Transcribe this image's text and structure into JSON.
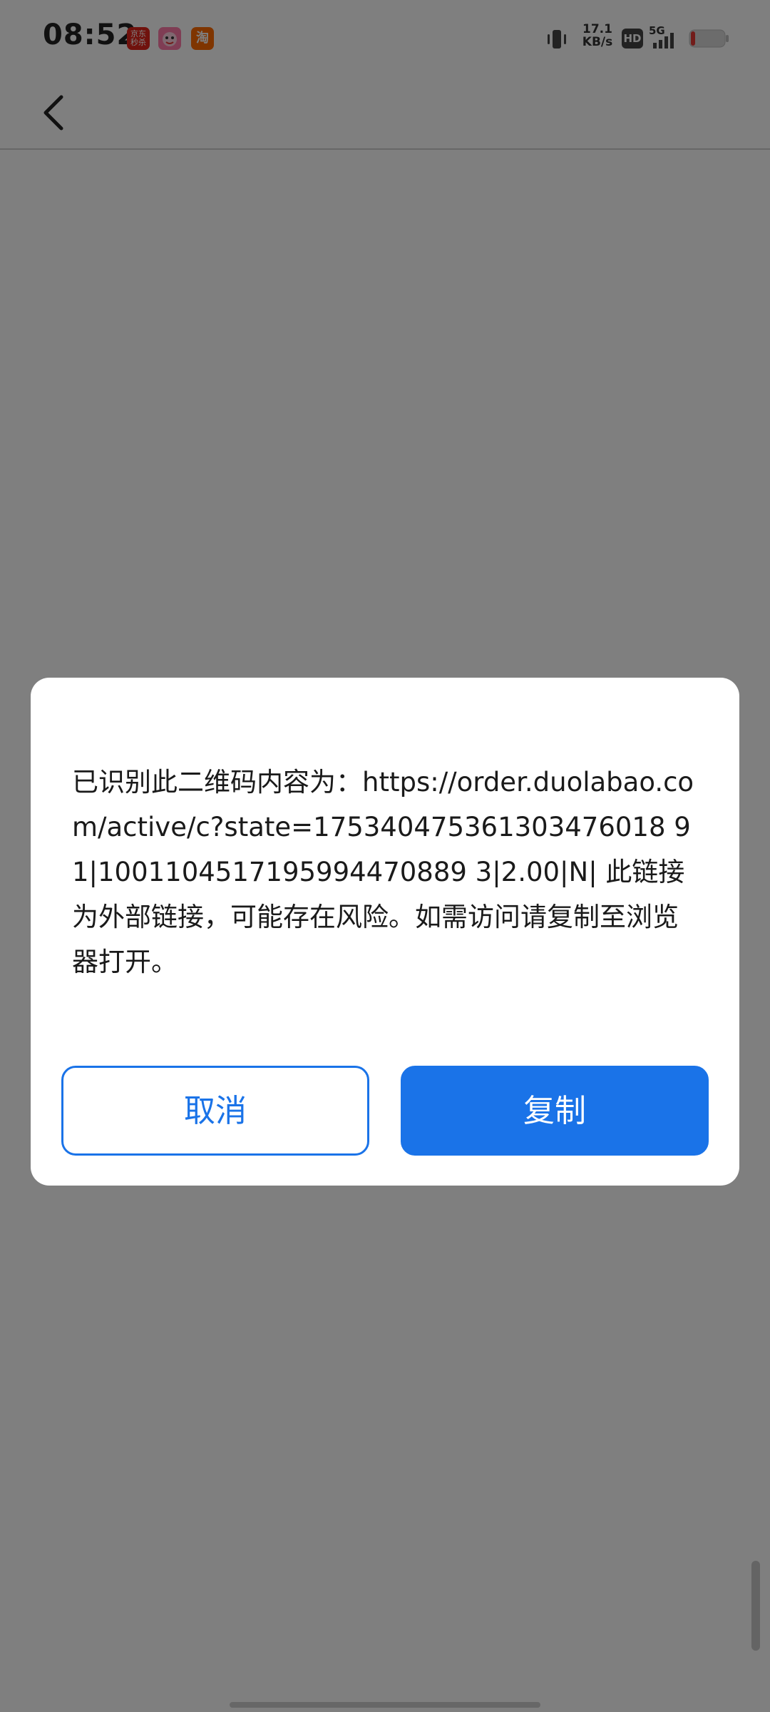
{
  "status_bar": {
    "time": "08:52",
    "app_icons": [
      {
        "name": "jd-icon",
        "label": "京东 秒杀"
      },
      {
        "name": "pink-app-icon",
        "label": ""
      },
      {
        "name": "taobao-icon",
        "label": "淘"
      }
    ],
    "network_speed_value": "17.1",
    "network_speed_unit": "KB/s",
    "hd_label": "HD",
    "signal_label": "5G",
    "battery_color": "#e53935"
  },
  "nav": {
    "back_icon": "chevron-left-icon"
  },
  "dialog": {
    "message": "已识别此二维码内容为：https://order.duolabao.com/active/c?state=175340475361303476018 91|1001104517195994470889 3|2.00|N| 此链接为外部链接，可能存在风险。如需访问请复制至浏览器打开。",
    "cancel_label": "取消",
    "copy_label": "复制"
  },
  "colors": {
    "accent": "#1a73e8",
    "overlay": "rgba(0,0,0,0.5)"
  }
}
